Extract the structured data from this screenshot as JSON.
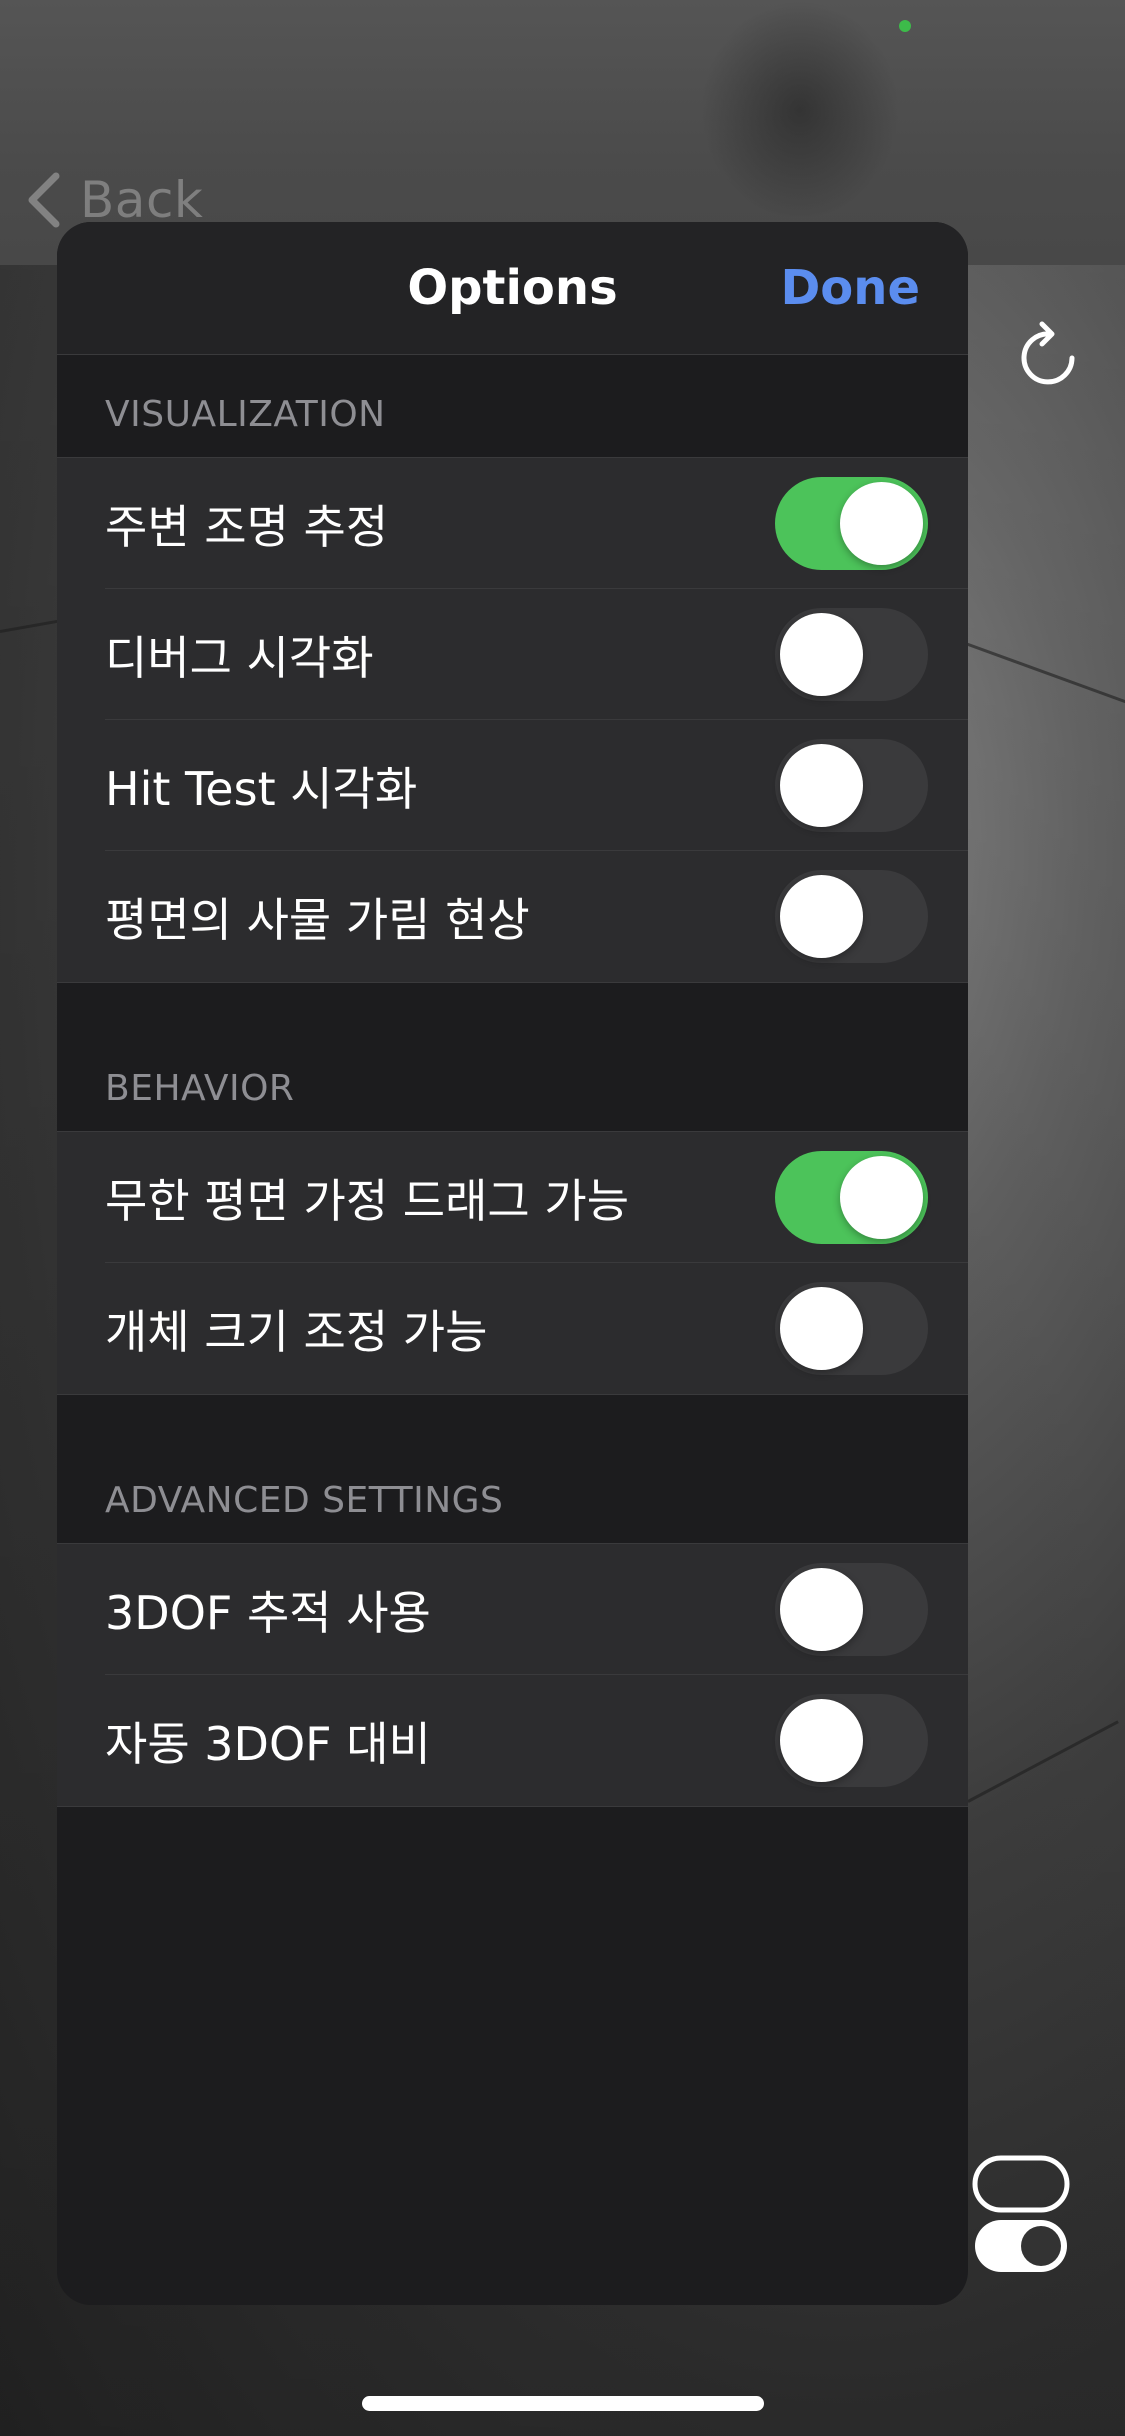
{
  "nav": {
    "back_label": "Back",
    "title": "Options",
    "done_label": "Done"
  },
  "sections": [
    {
      "header": "VISUALIZATION",
      "rows": [
        {
          "label": "주변 조명 추정",
          "on": true
        },
        {
          "label": "디버그 시각화",
          "on": false
        },
        {
          "label": "Hit Test 시각화",
          "on": false
        },
        {
          "label": "평면의 사물 가림 현상",
          "on": false
        }
      ]
    },
    {
      "header": "BEHAVIOR",
      "rows": [
        {
          "label": "무한 평면 가정 드래그 가능",
          "on": true
        },
        {
          "label": "개체 크기 조정 가능",
          "on": false
        }
      ]
    },
    {
      "header": "ADVANCED SETTINGS",
      "rows": [
        {
          "label": "3DOF 추적 사용",
          "on": false
        },
        {
          "label": "자동 3DOF 대비",
          "on": false
        }
      ]
    }
  ],
  "icons": {
    "back": "chevron-left-icon",
    "refresh": "refresh-icon",
    "placement": "object-placement-icon"
  },
  "colors": {
    "accent": "#5b8def",
    "toggle_on": "#4cc35a",
    "toggle_off": "#3a3a3c",
    "status_dot": "#3dbb4a"
  }
}
